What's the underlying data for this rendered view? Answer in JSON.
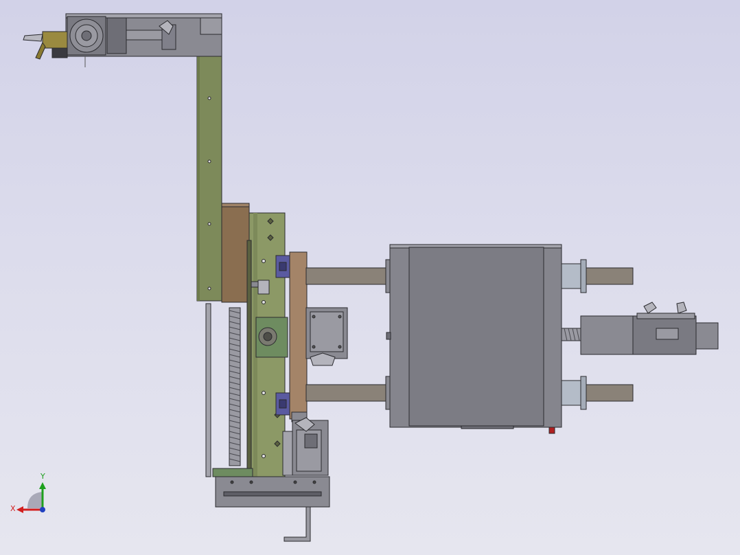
{
  "viewport": {
    "background_top": "#d2d2e8",
    "background_bottom": "#e6e6ef"
  },
  "triad": {
    "x_label": "X",
    "y_label": "Y",
    "x_color": "#d21e1e",
    "y_color": "#1ea01e",
    "z_color": "#2040c0"
  },
  "colors": {
    "olive_plate": "#7d8a5a",
    "olive_plate_light": "#8c9966",
    "brown_plate": "#8a6e50",
    "steel": "#8a8a92",
    "steel_dark": "#6e6e76",
    "steel_light": "#a4a4ac",
    "rod": "#8a8278",
    "flange": "#b4bcc8",
    "blue_block": "#5a5aa0",
    "accent_red": "#b02020",
    "outline": "#2a2a2e"
  },
  "icons": {
    "triad": "xyz-axis-triad-icon"
  }
}
